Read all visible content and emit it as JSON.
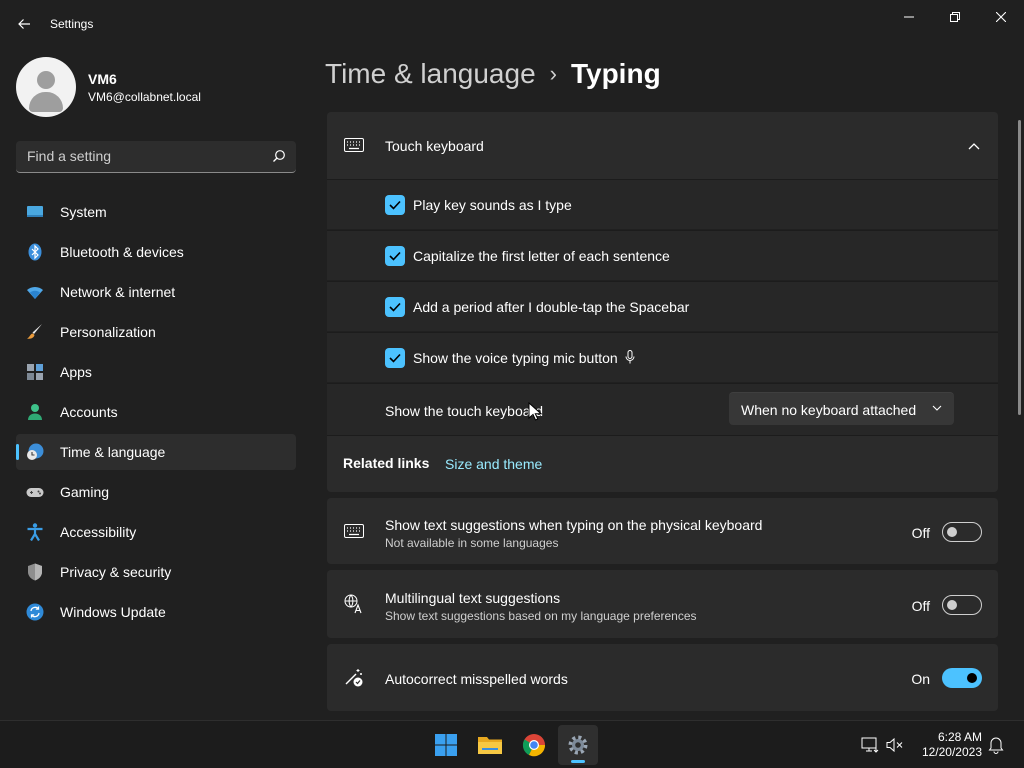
{
  "window": {
    "title": "Settings"
  },
  "profile": {
    "name": "VM6",
    "email": "VM6@collabnet.local"
  },
  "search": {
    "placeholder": "Find a setting",
    "value": ""
  },
  "sidebar": {
    "items": [
      {
        "label": "System",
        "icon": "system-icon"
      },
      {
        "label": "Bluetooth & devices",
        "icon": "bluetooth-icon"
      },
      {
        "label": "Network & internet",
        "icon": "wifi-icon"
      },
      {
        "label": "Personalization",
        "icon": "brush-icon"
      },
      {
        "label": "Apps",
        "icon": "apps-icon"
      },
      {
        "label": "Accounts",
        "icon": "person-icon"
      },
      {
        "label": "Time & language",
        "icon": "globe-clock-icon",
        "active": true
      },
      {
        "label": "Gaming",
        "icon": "gamepad-icon"
      },
      {
        "label": "Accessibility",
        "icon": "accessibility-icon"
      },
      {
        "label": "Privacy & security",
        "icon": "shield-icon"
      },
      {
        "label": "Windows Update",
        "icon": "update-icon"
      }
    ]
  },
  "breadcrumb": {
    "parent": "Time & language",
    "separator": "›",
    "current": "Typing"
  },
  "touch_keyboard": {
    "title": "Touch keyboard",
    "expanded": true,
    "options": [
      {
        "label": "Play key sounds as I type",
        "checked": true
      },
      {
        "label": "Capitalize the first letter of each sentence",
        "checked": true
      },
      {
        "label": "Add a period after I double-tap the Spacebar",
        "checked": true
      },
      {
        "label": "Show the voice typing mic button",
        "checked": true
      }
    ],
    "show_keyboard": {
      "label": "Show the touch keyboard",
      "selected": "When no keyboard attached"
    },
    "related": {
      "title": "Related links",
      "link": "Size and theme"
    }
  },
  "settings": [
    {
      "title": "Show text suggestions when typing on the physical keyboard",
      "subtitle": "Not available in some languages",
      "state": "Off",
      "on": false
    },
    {
      "title": "Multilingual text suggestions",
      "subtitle": "Show text suggestions based on my language preferences",
      "state": "Off",
      "on": false
    },
    {
      "title": "Autocorrect misspelled words",
      "subtitle": "",
      "state": "On",
      "on": true
    }
  ],
  "taskbar": {
    "time": "6:28 AM",
    "date": "12/20/2023"
  },
  "colors": {
    "accent": "#4cc2ff",
    "background": "#202020",
    "card": "#2b2b2b",
    "link": "#99ebff"
  }
}
